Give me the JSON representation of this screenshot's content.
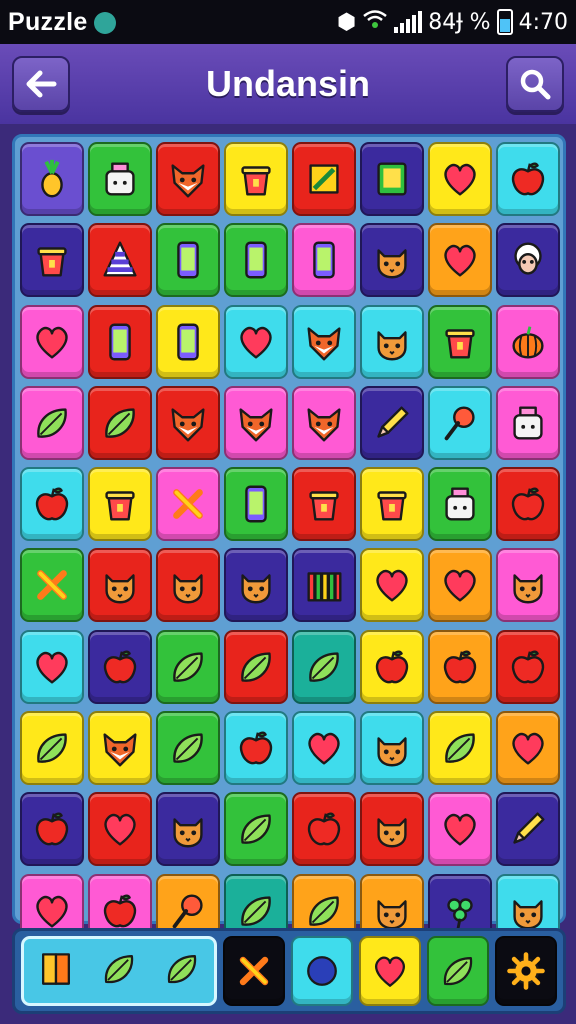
{
  "status_bar": {
    "app_name": "Puzzle",
    "battery_text": "84Ɉ %",
    "time": "4:70"
  },
  "header": {
    "title": "Undansin",
    "back_icon": "back-arrow-icon",
    "search_icon": "search-icon"
  },
  "colors": {
    "background": "#3b2a7a",
    "header": "#5a3fa8",
    "board": "#5f9fd3",
    "dock": "#2a5fa0"
  },
  "board": {
    "rows": 10,
    "cols": 8,
    "tiles": [
      [
        {
          "color": "#6a4fd0",
          "icon": "pineapple"
        },
        {
          "color": "#33c23b",
          "icon": "toaster"
        },
        {
          "color": "#e8241c",
          "icon": "fox-face"
        },
        {
          "color": "#ffe81a",
          "icon": "cup"
        },
        {
          "color": "#e8241c",
          "icon": "brush-box"
        },
        {
          "color": "#3b2a9e",
          "icon": "tablet"
        },
        {
          "color": "#ffe81a",
          "icon": "heart"
        },
        {
          "color": "#3fdcec",
          "icon": "apple"
        }
      ],
      [
        {
          "color": "#3b2a9e",
          "icon": "cup"
        },
        {
          "color": "#e8241c",
          "icon": "cone-stack"
        },
        {
          "color": "#33c23b",
          "icon": "phone"
        },
        {
          "color": "#33c23b",
          "icon": "phone"
        },
        {
          "color": "#ff5ad4",
          "icon": "phone"
        },
        {
          "color": "#3b2a9e",
          "icon": "cat-face"
        },
        {
          "color": "#ffa31a",
          "icon": "heart"
        },
        {
          "color": "#3b2a9e",
          "icon": "sheep-face"
        }
      ],
      [
        {
          "color": "#ff5ad4",
          "icon": "heart"
        },
        {
          "color": "#e8241c",
          "icon": "phone"
        },
        {
          "color": "#ffe81a",
          "icon": "phone"
        },
        {
          "color": "#3fdcec",
          "icon": "heart"
        },
        {
          "color": "#3fdcec",
          "icon": "fox-face"
        },
        {
          "color": "#3fdcec",
          "icon": "cat-face"
        },
        {
          "color": "#33c23b",
          "icon": "cup"
        },
        {
          "color": "#ff5ad4",
          "icon": "pumpkin"
        }
      ],
      [
        {
          "color": "#ff5ad4",
          "icon": "leaf"
        },
        {
          "color": "#e8241c",
          "icon": "leaf"
        },
        {
          "color": "#e8241c",
          "icon": "fox-face"
        },
        {
          "color": "#ff5ad4",
          "icon": "fox-face"
        },
        {
          "color": "#ff5ad4",
          "icon": "fox-face"
        },
        {
          "color": "#3b2a9e",
          "icon": "pencil"
        },
        {
          "color": "#3fdcec",
          "icon": "lollipop"
        },
        {
          "color": "#ff5ad4",
          "icon": "toaster"
        }
      ],
      [
        {
          "color": "#3fdcec",
          "icon": "apple"
        },
        {
          "color": "#ffe81a",
          "icon": "cup"
        },
        {
          "color": "#ff5ad4",
          "icon": "cross"
        },
        {
          "color": "#33c23b",
          "icon": "phone"
        },
        {
          "color": "#e8241c",
          "icon": "cup"
        },
        {
          "color": "#ffe81a",
          "icon": "cup"
        },
        {
          "color": "#33c23b",
          "icon": "toaster"
        },
        {
          "color": "#e8241c",
          "icon": "apple"
        }
      ],
      [
        {
          "color": "#33c23b",
          "icon": "cross"
        },
        {
          "color": "#e8241c",
          "icon": "cat-face"
        },
        {
          "color": "#e8241c",
          "icon": "cat-face"
        },
        {
          "color": "#3b2a9e",
          "icon": "cat-face"
        },
        {
          "color": "#3b2a9e",
          "icon": "books"
        },
        {
          "color": "#ffe81a",
          "icon": "heart"
        },
        {
          "color": "#ffa31a",
          "icon": "heart"
        },
        {
          "color": "#ff5ad4",
          "icon": "cat-face"
        }
      ],
      [
        {
          "color": "#3fdcec",
          "icon": "heart"
        },
        {
          "color": "#3b2a9e",
          "icon": "apple"
        },
        {
          "color": "#33c23b",
          "icon": "leaf"
        },
        {
          "color": "#e8241c",
          "icon": "leaf"
        },
        {
          "color": "#1bb09a",
          "icon": "leaf"
        },
        {
          "color": "#ffe81a",
          "icon": "apple"
        },
        {
          "color": "#ffa31a",
          "icon": "apple"
        },
        {
          "color": "#e8241c",
          "icon": "apple"
        }
      ],
      [
        {
          "color": "#ffe81a",
          "icon": "leaf"
        },
        {
          "color": "#ffe81a",
          "icon": "fox-face"
        },
        {
          "color": "#33c23b",
          "icon": "leaf"
        },
        {
          "color": "#3fdcec",
          "icon": "apple"
        },
        {
          "color": "#3fdcec",
          "icon": "heart"
        },
        {
          "color": "#3fdcec",
          "icon": "cat-face"
        },
        {
          "color": "#ffe81a",
          "icon": "leaf"
        },
        {
          "color": "#ffa31a",
          "icon": "heart"
        }
      ],
      [
        {
          "color": "#3b2a9e",
          "icon": "apple"
        },
        {
          "color": "#e8241c",
          "icon": "heart"
        },
        {
          "color": "#3b2a9e",
          "icon": "cat-face"
        },
        {
          "color": "#33c23b",
          "icon": "leaf"
        },
        {
          "color": "#e8241c",
          "icon": "apple"
        },
        {
          "color": "#e8241c",
          "icon": "cat-face"
        },
        {
          "color": "#ff5ad4",
          "icon": "heart"
        },
        {
          "color": "#3b2a9e",
          "icon": "pencil"
        }
      ],
      [
        {
          "color": "#ff5ad4",
          "icon": "heart"
        },
        {
          "color": "#ff5ad4",
          "icon": "apple"
        },
        {
          "color": "#ffa31a",
          "icon": "lollipop"
        },
        {
          "color": "#1bb09a",
          "icon": "leaf"
        },
        {
          "color": "#ffa31a",
          "icon": "leaf"
        },
        {
          "color": "#ffa31a",
          "icon": "cat-face"
        },
        {
          "color": "#3b2a9e",
          "icon": "clover"
        },
        {
          "color": "#3fdcec",
          "icon": "cat-face"
        }
      ]
    ]
  },
  "dock": {
    "group": [
      {
        "icon": "book"
      },
      {
        "icon": "leaf"
      },
      {
        "icon": "leaf"
      }
    ],
    "tiles": [
      {
        "color": "#0b0b12",
        "icon": "cross"
      },
      {
        "color": "#3fdcec",
        "icon": "circle"
      },
      {
        "color": "#ffe81a",
        "icon": "heart"
      },
      {
        "color": "#33c23b",
        "icon": "leaf"
      },
      {
        "color": "#0b0b12",
        "icon": "gear"
      }
    ]
  }
}
